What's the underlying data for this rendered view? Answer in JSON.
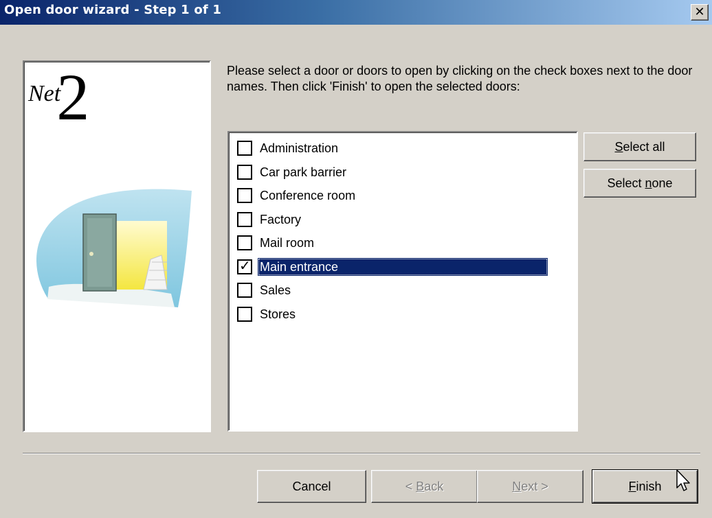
{
  "window": {
    "title": "Open door wizard - Step 1 of 1",
    "close_label": "✕"
  },
  "logo": {
    "prefix": "Net",
    "number": "2"
  },
  "instructions": "Please select a door or doors to open by clicking on the check boxes next to the door names. Then click 'Finish' to open the selected doors:",
  "doors": [
    {
      "name": "Administration",
      "checked": false,
      "selected": false
    },
    {
      "name": "Car park barrier",
      "checked": false,
      "selected": false
    },
    {
      "name": "Conference room",
      "checked": false,
      "selected": false
    },
    {
      "name": "Factory",
      "checked": false,
      "selected": false
    },
    {
      "name": "Mail room",
      "checked": false,
      "selected": false
    },
    {
      "name": "Main entrance",
      "checked": true,
      "selected": true
    },
    {
      "name": "Sales",
      "checked": false,
      "selected": false
    },
    {
      "name": "Stores",
      "checked": false,
      "selected": false
    }
  ],
  "side_buttons": {
    "select_all": {
      "mnemonic": "S",
      "rest": "elect all"
    },
    "select_none": {
      "before": "Select ",
      "mnemonic": "n",
      "rest": "one"
    }
  },
  "footer_buttons": {
    "cancel": "Cancel",
    "back": {
      "before": "< ",
      "mnemonic": "B",
      "rest": "ack"
    },
    "next": {
      "mnemonic": "N",
      "rest": "ext >"
    },
    "finish": {
      "mnemonic": "F",
      "rest": "inish"
    }
  },
  "colors": {
    "title_gradient_start": "#0a246a",
    "title_gradient_end": "#a6caf0",
    "selection_bg": "#0a246a",
    "face": "#d4d0c8"
  }
}
